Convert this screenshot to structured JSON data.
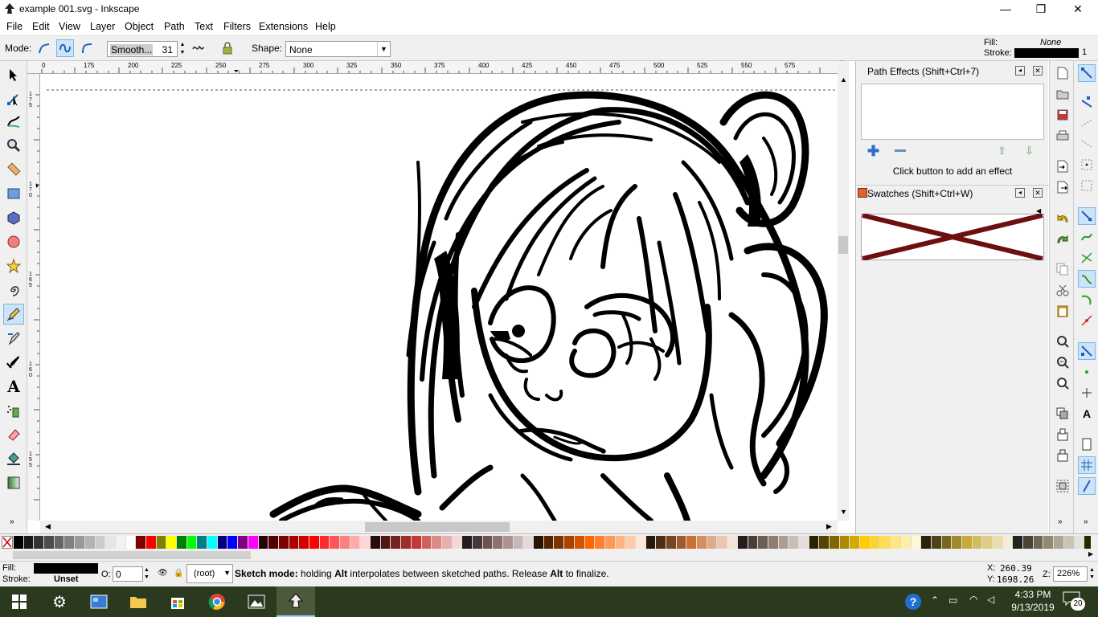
{
  "window": {
    "title": "example 001.svg - Inkscape",
    "minimize": "—",
    "restore": "❐",
    "close": "✕"
  },
  "menu": [
    "File",
    "Edit",
    "View",
    "Layer",
    "Object",
    "Path",
    "Text",
    "Filters",
    "Extensions",
    "Help"
  ],
  "toolctrl": {
    "mode_label": "Mode:",
    "smoothing_label": "Smooth...",
    "smoothing_value": "31",
    "shape_label": "Shape:",
    "shape_value": "None"
  },
  "fillstroke": {
    "fill_label": "Fill:",
    "fill_value": "None",
    "stroke_label": "Stroke:",
    "stroke_width": "1"
  },
  "ruler_h": [
    "0",
    "175",
    "200",
    "225",
    "250",
    "275",
    "300",
    "325",
    "350",
    "375",
    "400",
    "425",
    "450",
    "475",
    "500",
    "525",
    "550",
    "575"
  ],
  "ruler_v": [
    "175",
    "170",
    "165",
    "160",
    "155"
  ],
  "path_effects": {
    "title": "Path Effects  (Shift+Ctrl+7)",
    "hint": "Click button to add an effect"
  },
  "swatches": {
    "title": "Swatches (Shift+Ctrl+W)"
  },
  "palette": [
    "#000000",
    "#1a1a1a",
    "#333333",
    "#4d4d4d",
    "#666666",
    "#808080",
    "#999999",
    "#b3b3b3",
    "#cccccc",
    "#e6e6e6",
    "#f2f2f2",
    "#ffffff",
    "#800000",
    "#ff0000",
    "#808000",
    "#ffff00",
    "#008000",
    "#00ff00",
    "#008080",
    "#00ffff",
    "#000080",
    "#0000ff",
    "#800080",
    "#ff00ff",
    "#2b0000",
    "#550000",
    "#800000",
    "#aa0000",
    "#d40000",
    "#ff0000",
    "#ff2a2a",
    "#ff5555",
    "#ff8080",
    "#ffaaaa",
    "#ffd5d5",
    "#280b0b",
    "#501616",
    "#782121",
    "#a02c2c",
    "#c83737",
    "#d35f5f",
    "#de8787",
    "#e9afaf",
    "#f4d7d7",
    "#241c1c",
    "#483737",
    "#6c5353",
    "#916f6f",
    "#ac9393",
    "#c8b7b7",
    "#e3dbdb",
    "#2b1100",
    "#552200",
    "#803300",
    "#aa4400",
    "#d45500",
    "#ff6600",
    "#ff7f2a",
    "#ff9955",
    "#ffb380",
    "#ffccaa",
    "#ffe6d5",
    "#28170b",
    "#502d16",
    "#784421",
    "#a05a2c",
    "#c87137",
    "#d38d5f",
    "#deaa87",
    "#e9c6af",
    "#f4e3d7",
    "#241f1c",
    "#483e37",
    "#6c5d53",
    "#917c6f",
    "#ac9d93",
    "#c8beb7",
    "#e3dedb",
    "#2b2200",
    "#554400",
    "#806600",
    "#aa8800",
    "#d4aa00",
    "#ffcc00",
    "#ffd42a",
    "#ffdd55",
    "#ffe680",
    "#ffeeaa",
    "#fff6d5",
    "#28220b",
    "#504416",
    "#786721",
    "#a0892c",
    "#c8ab37",
    "#d3bc5f",
    "#decd87",
    "#e9ddaf",
    "#f4eed7",
    "#24221c",
    "#484537",
    "#6c6753",
    "#918a6f",
    "#aca793",
    "#c8c4b7",
    "#e3e2db",
    "#222b00",
    "#445500",
    "#668000",
    "#88aa00",
    "#aad400"
  ],
  "status": {
    "fill_label": "Fill:",
    "stroke_label": "Stroke:",
    "stroke_value": "Unset",
    "opacity_label": "O:",
    "opacity_value": "0",
    "layer": "(root)",
    "msg_bold1": "Sketch mode:",
    "msg_part1": " holding ",
    "msg_bold2": "Alt",
    "msg_part2": " interpolates between sketched paths. Release ",
    "msg_bold3": "Alt",
    "msg_part3": " to finalize.",
    "x_label": "X:",
    "x_value": "260.39",
    "y_label": "Y:",
    "y_value": "1698.26",
    "zoom_label": "Z:",
    "zoom_value": "226%"
  },
  "taskbar": {
    "time": "4:33 PM",
    "date": "9/13/2019",
    "notif_count": "20"
  }
}
